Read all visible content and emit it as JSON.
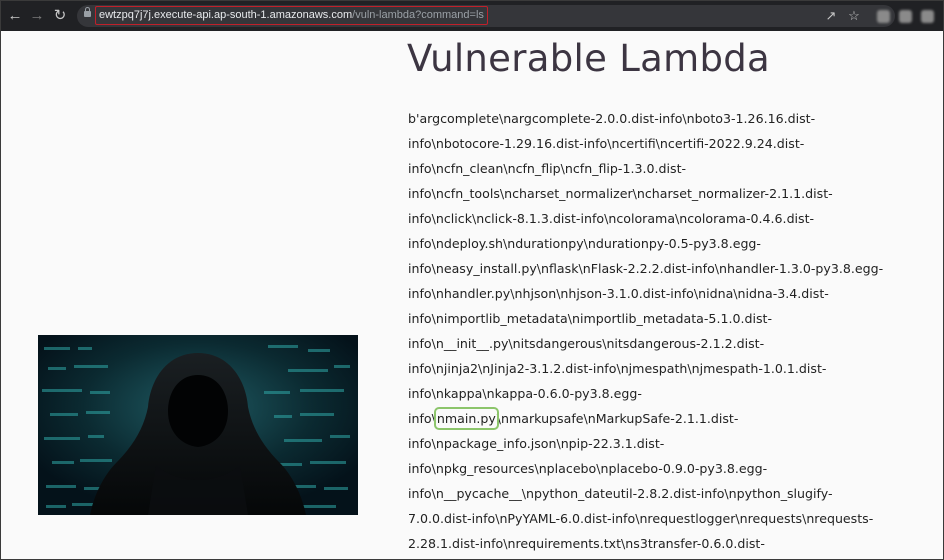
{
  "browser": {
    "url_host": "ewtzpq7j7j.execute-api.ap-south-1.amazonaws.com",
    "url_path": "/vuln-lambda?command=ls"
  },
  "page": {
    "title": "Vulnerable Lambda",
    "highlighted_item": "nmain.py",
    "listing_lines": [
      "b'argcomplete\\nargcomplete-2.0.0.dist-info\\nboto3-1.26.16.dist-",
      "info\\nbotocore-1.29.16.dist-info\\ncertifi\\ncertifi-2022.9.24.dist-",
      "info\\ncfn_clean\\ncfn_flip\\ncfn_flip-1.3.0.dist-",
      "info\\ncfn_tools\\ncharset_normalizer\\ncharset_normalizer-2.1.1.dist-",
      "info\\nclick\\nclick-8.1.3.dist-info\\ncolorama\\ncolorama-0.4.6.dist-",
      "info\\ndeploy.sh\\ndurationpy\\ndurationpy-0.5-py3.8.egg-",
      "info\\neasy_install.py\\nflask\\nFlask-2.2.2.dist-info\\nhandler-1.3.0-py3.8.egg-",
      "info\\nhandler.py\\nhjson\\nhjson-3.1.0.dist-info\\nidna\\nidna-3.4.dist-",
      "info\\nimportlib_metadata\\nimportlib_metadata-5.1.0.dist-",
      "info\\n__init__.py\\nitsdangerous\\nitsdangerous-2.1.2.dist-",
      "info\\njinja2\\nJinja2-3.1.2.dist-info\\njmespath\\njmespath-1.0.1.dist-",
      "info\\nkappa\\nkappa-0.6.0-py3.8.egg-",
      "info\\nmain.py\\nmarkupsafe\\nMarkupSafe-2.1.1.dist-",
      "info\\npackage_info.json\\npip-22.3.1.dist-",
      "info\\npkg_resources\\nplacebo\\nplacebo-0.9.0-py3.8.egg-",
      "info\\n__pycache__\\npython_dateutil-2.8.2.dist-info\\npython_slugify-",
      "7.0.0.dist-info\\nPyYAML-6.0.dist-info\\nrequestlogger\\nrequests\\nrequests-",
      "2.28.1.dist-info\\nrequirements.txt\\ns3transfer-0.6.0.dist-"
    ]
  },
  "icons": [
    "back-arrow-icon",
    "forward-arrow-icon",
    "reload-icon",
    "lock-icon",
    "share-icon",
    "star-icon",
    "extension-icon"
  ],
  "colors": {
    "toolbar": "#202124",
    "url_highlight": "#c0202a",
    "file_highlight": "#8cc56b",
    "title": "#3c3542"
  }
}
